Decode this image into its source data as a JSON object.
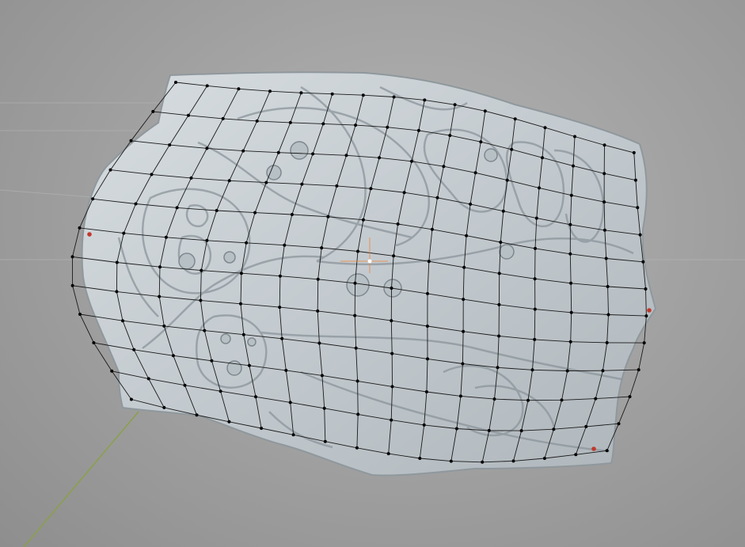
{
  "viewport": {
    "background_color": "#a3a3a3",
    "mesh_color": "#c9d0d4",
    "wire_color": "#1a1a1a",
    "vertex_color": "#000000",
    "selected_vertex_color": "#c0392b",
    "x_axis_color": "#8aa04a",
    "origin_color": "#f08030"
  }
}
